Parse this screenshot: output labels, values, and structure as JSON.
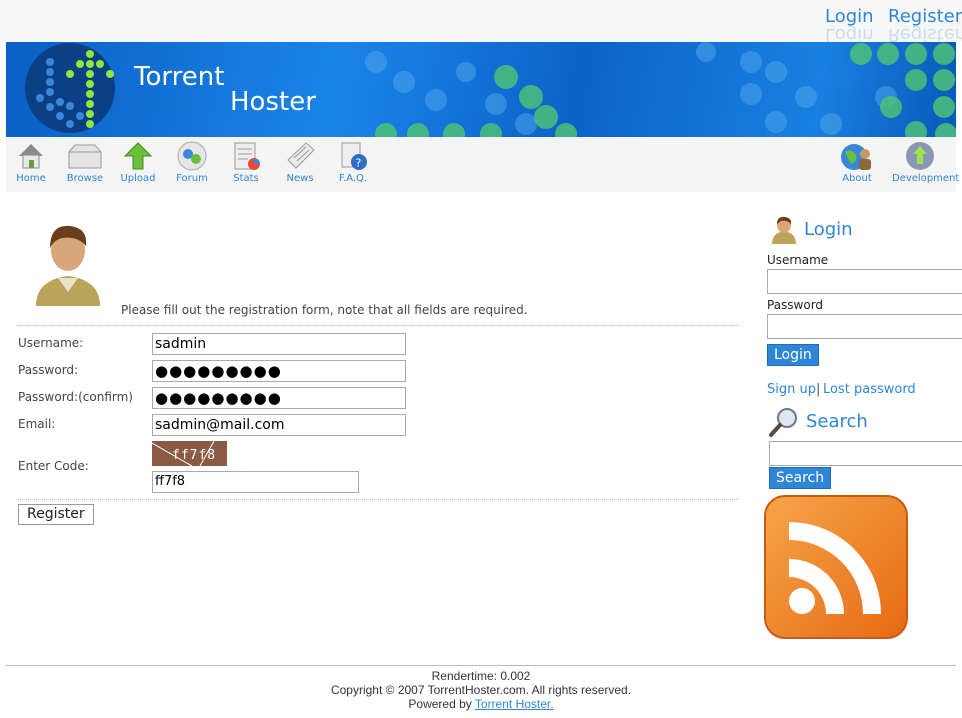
{
  "top_links": {
    "login": "Login",
    "register": "Register"
  },
  "banner": {
    "title_line1": "Torrent",
    "title_line2": "Hoster"
  },
  "nav": {
    "items": [
      "Home",
      "Browse",
      "Upload",
      "Forum",
      "Stats",
      "News",
      "F.A.Q."
    ],
    "right_items": [
      "About",
      "Development"
    ]
  },
  "register_form": {
    "intro": "Please fill out the registration form, note that all fields are required.",
    "username_label": "Username:",
    "username_value": "sadmin",
    "password_label": "Password:",
    "password_value": "●●●●●●●●●",
    "password_confirm_label": "Password:(confirm)",
    "password_confirm_value": "●●●●●●●●●",
    "email_label": "Email:",
    "email_value": "sadmin@mail.com",
    "code_label": "Enter Code:",
    "captcha_text": "ff7f8",
    "code_value": "ff7f8",
    "submit_label": "Register"
  },
  "sidebar": {
    "login_heading": "Login",
    "username_label": "Username",
    "password_label": "Password",
    "login_button": "Login",
    "signup_link": "Sign up",
    "separator": "|",
    "lost_password_link": "Lost password",
    "search_heading": "Search",
    "search_button": "Search"
  },
  "footer": {
    "rendertime": "Rendertime: 0.002",
    "copyright": "Copyright © 2007 TorrentHoster.com. All rights reserved.",
    "powered_prefix": "Powered by",
    "powered_link": "Torrent Hoster."
  },
  "colors": {
    "accent": "#2e86d6",
    "banner": "#1a84e8",
    "rss": "#f08a24"
  }
}
